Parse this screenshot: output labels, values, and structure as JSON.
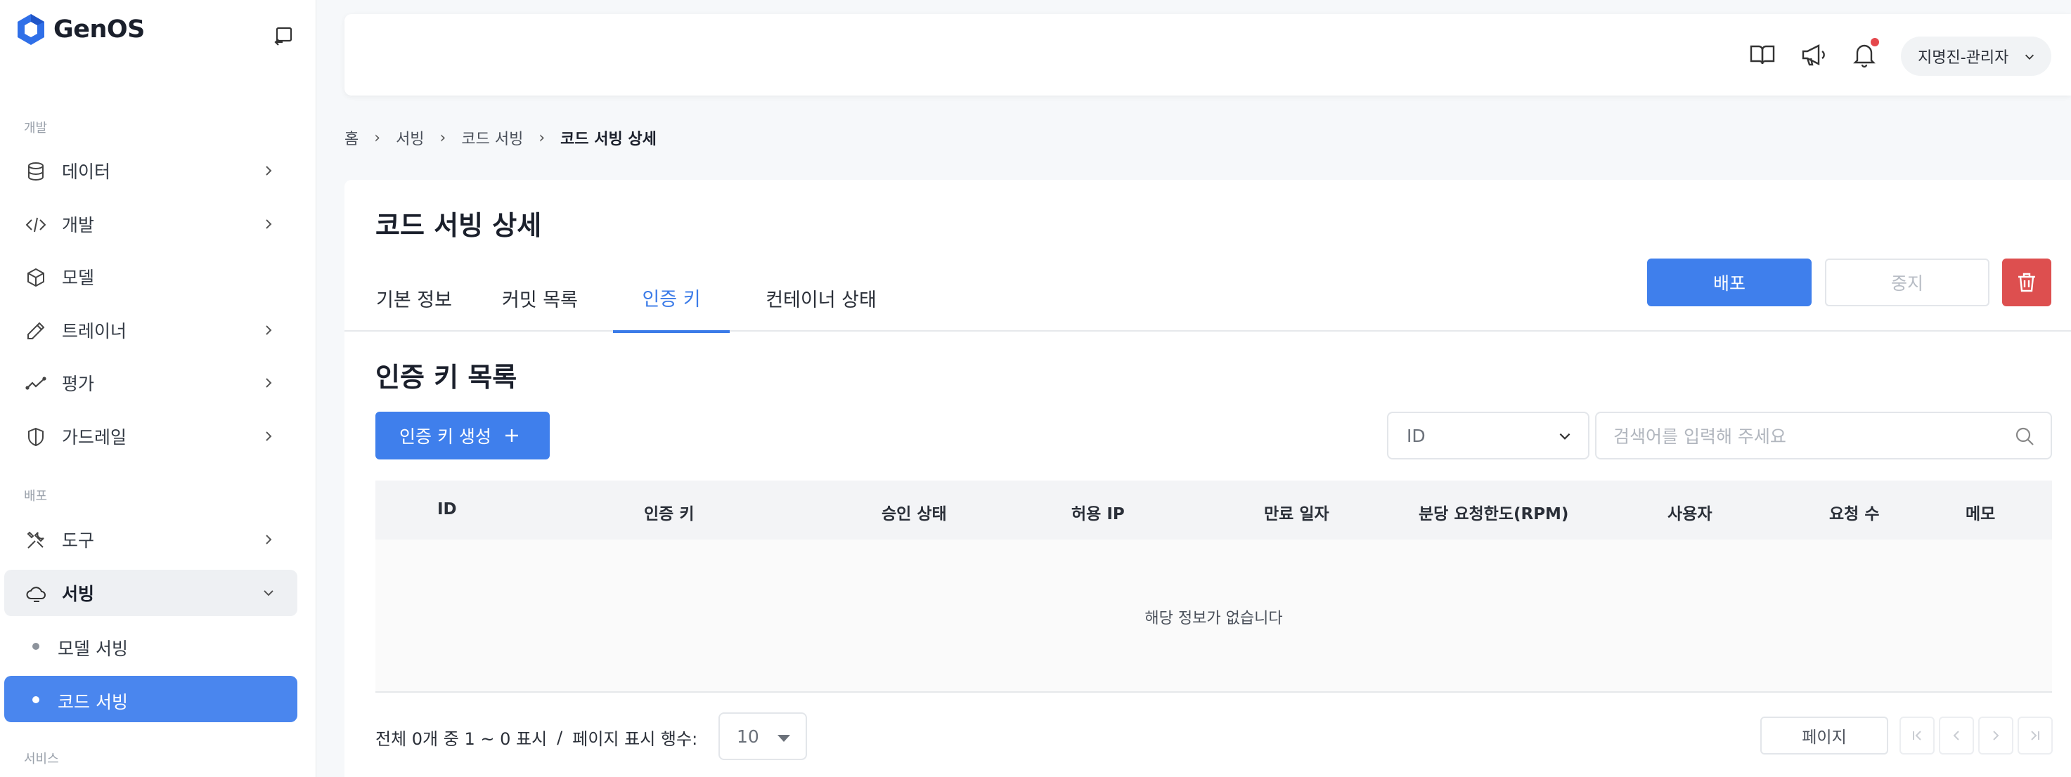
{
  "app": {
    "brand": "GenOS"
  },
  "sidebar": {
    "section_dev": "개발",
    "section_deploy": "배포",
    "section_service": "서비스",
    "items": [
      {
        "label": "데이터",
        "icon": "database-icon"
      },
      {
        "label": "개발",
        "icon": "code-icon"
      },
      {
        "label": "모델",
        "icon": "cube-icon"
      },
      {
        "label": "트레이너",
        "icon": "pencil-icon"
      },
      {
        "label": "평가",
        "icon": "trend-line-icon"
      },
      {
        "label": "가드레일",
        "icon": "shield-icon"
      },
      {
        "label": "도구",
        "icon": "tools-icon"
      },
      {
        "label": "서빙",
        "icon": "cloud-icon"
      }
    ],
    "sub_items": [
      {
        "label": "모델 서빙"
      },
      {
        "label": "코드 서빙"
      }
    ]
  },
  "header": {
    "user_label": "지명진-관리자",
    "icons": [
      "book-icon",
      "megaphone-icon",
      "bell-icon"
    ]
  },
  "breadcrumb": {
    "items": [
      "홈",
      "서빙",
      "코드 서빙"
    ],
    "current": "코드 서빙 상세"
  },
  "main": {
    "title": "코드 서빙 상세",
    "tabs": [
      {
        "label": "기본 정보"
      },
      {
        "label": "커밋 목록"
      },
      {
        "label": "인증 키"
      },
      {
        "label": "컨테이너 상태"
      }
    ],
    "active_tab": "인증 키",
    "actions": {
      "deploy": "배포",
      "stop": "중지"
    },
    "section_title": "인증 키 목록",
    "create_button": "인증 키 생성",
    "filter_select": "ID",
    "search_placeholder": "검색어를 입력해 주세요",
    "table": {
      "columns": [
        "ID",
        "인증 키",
        "승인 상태",
        "허용 IP",
        "만료 일자",
        "분당 요청한도(RPM)",
        "사용자",
        "요청 수",
        "메모"
      ],
      "empty_message": "해당 정보가 없습니다"
    },
    "footer": {
      "summary": "전체 0개 중 1 ~ 0 표시",
      "divider": "/",
      "rows_label": "페이지 표시 행수:",
      "rows_value": "10",
      "page_label": "페이지"
    }
  },
  "colors": {
    "accent": "#3f7fec",
    "danger": "#dd4f4f",
    "notification": "#e5484d"
  }
}
